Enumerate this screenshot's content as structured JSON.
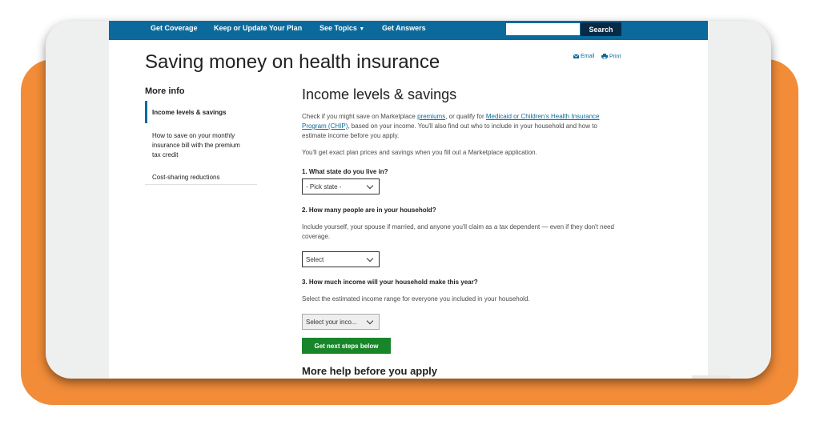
{
  "nav": {
    "links": [
      "Get Coverage",
      "Keep or Update Your Plan",
      "See Topics",
      "Get Answers"
    ],
    "caret": "▼",
    "search_label": "Search"
  },
  "header": {
    "title": "Saving money on health insurance",
    "email_label": "Email",
    "print_label": "Print"
  },
  "sidebar": {
    "title": "More info",
    "items": [
      "Income levels & savings",
      "How to save on your monthly insurance bill with the premium tax credit",
      "Cost-sharing reductions"
    ]
  },
  "main": {
    "heading": "Income levels & savings",
    "intro": {
      "t1": "Check if you might save on Marketplace ",
      "link_premiums": "premiums",
      "t2": ", or qualify for ",
      "link_medicaid": "Medicaid or Children's Health Insurance Program (CHIP)",
      "t3": ", based on your income. You'll also find out who to include in your household and how to estimate income before you apply."
    },
    "exact_prices": "You'll get exact plan prices and savings when you fill out a Marketplace application.",
    "q1": {
      "label": "1. What state do you live in?",
      "select": "- Pick state -"
    },
    "q2": {
      "label": "2. How many people are in your household?",
      "help": "Include yourself, your spouse if married, and anyone you'll claim as a tax dependent — even if they don't need coverage.",
      "select": "Select"
    },
    "q3": {
      "label": "3. How much income will your household make this year?",
      "help": "Select the estimated income range for everyone you included in your household.",
      "select": "Select your inco..."
    },
    "cta": "Get next steps below",
    "more_help": "More help before you apply"
  }
}
